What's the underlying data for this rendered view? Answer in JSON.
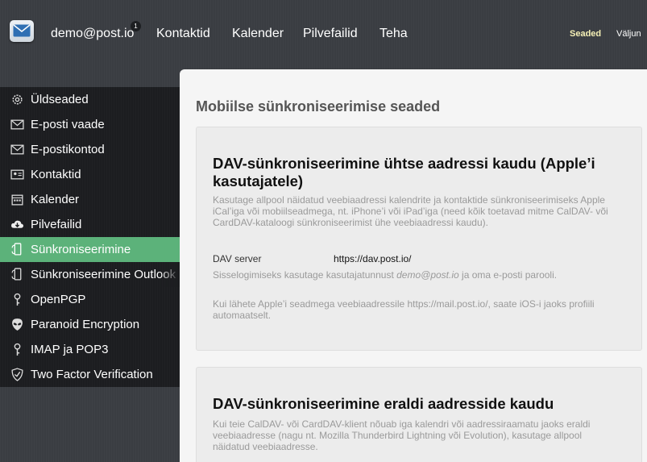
{
  "header": {
    "account": "demo@post.io",
    "badge_count": "1",
    "nav": [
      "Kontaktid",
      "Kalender",
      "Pilvefailid",
      "Teha"
    ],
    "settings_label": "Seaded",
    "logout_label": "Väljun"
  },
  "sidebar": {
    "items": [
      {
        "label": "Üldseaded",
        "icon": "gear-icon"
      },
      {
        "label": "E-posti vaade",
        "icon": "envelope-icon"
      },
      {
        "label": "E-postikontod",
        "icon": "envelope-icon"
      },
      {
        "label": "Kontaktid",
        "icon": "contact-card-icon"
      },
      {
        "label": "Kalender",
        "icon": "calendar-icon"
      },
      {
        "label": "Pilvefailid",
        "icon": "cloud-download-icon"
      },
      {
        "label": "Sünkroniseerimine",
        "icon": "sync-phone-icon",
        "active": true
      },
      {
        "label": "Sünkroniseerimine Outlook",
        "icon": "sync-phone-icon"
      },
      {
        "label": "OpenPGP",
        "icon": "key-icon"
      },
      {
        "label": "Paranoid Encryption",
        "icon": "alien-icon"
      },
      {
        "label": "IMAP ja POP3",
        "icon": "key-icon"
      },
      {
        "label": "Two Factor Verification",
        "icon": "shield-icon"
      }
    ],
    "active_color": "#5cb27a"
  },
  "main": {
    "title": "Mobiilse sünkroniseerimise seaded",
    "card1": {
      "heading": "DAV-sünkroniseerimine ühtse aadressi kaudu (Apple’i kasutajatele)",
      "description": "Kasutage allpool näidatud veebiaadressi kalendrite ja kontaktide sünkroniseerimiseks Apple iCal’iga või mobiilseadmega, nt. iPhone’i või iPad’iga (need kõik toetavad mitme CalDAV- või CardDAV-kataloogi sünkroniseerimist ühe veebiaadressi kaudu).",
      "server_label": "DAV server",
      "server_value": "https://dav.post.io/",
      "login_hint_prefix": "Sisselogimiseks kasutage kasutajatunnust ",
      "login_hint_email": "demo@post.io",
      "login_hint_suffix": " ja oma e-posti parooli.",
      "apple_hint": "Kui lähete Apple’i seadmega veebiaadressile https://mail.post.io/, saate iOS-i jaoks profiili automaatselt."
    },
    "card2": {
      "heading": "DAV-sünkroniseerimine eraldi aadresside kaudu",
      "description": "Kui teie CalDAV- või CardDAV-klient nõuab iga kalendri või aadressiraamatu jaoks eraldi veebiaadresse (nagu nt. Mozilla Thunderbird Lightning või Evolution), kasutage allpool näidatud veebiaadresse."
    }
  }
}
